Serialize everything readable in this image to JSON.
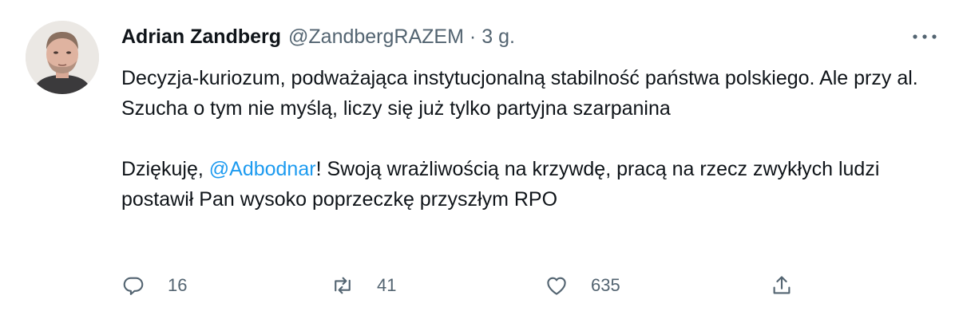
{
  "tweet": {
    "author_name": "Adrian Zandberg",
    "handle": "@ZandbergRAZEM",
    "separator": "·",
    "time": "3 g.",
    "paragraph1": "Decyzja-kuriozum, podważająca instytucjonalną stabilność państwa polskiego. Ale przy al. Szucha o tym nie myślą, liczy się już tylko partyjna szarpanina",
    "paragraph2_before": "Dziękuję, ",
    "mention": "@Adbodnar",
    "paragraph2_after": "! Swoją wrażliwością na krzywdę, pracą na rzecz zwykłych ludzi postawił Pan wysoko poprzeczkę przyszłym RPO"
  },
  "actions": {
    "reply_count": "16",
    "retweet_count": "41",
    "like_count": "635"
  },
  "icons": {
    "more": "more-horizontal-icon",
    "reply": "reply-bubble-icon",
    "retweet": "retweet-arrows-icon",
    "like": "heart-icon",
    "share": "share-upload-icon"
  },
  "colors": {
    "text": "#0f1419",
    "secondary": "#536471",
    "link": "#1d9bf0"
  }
}
